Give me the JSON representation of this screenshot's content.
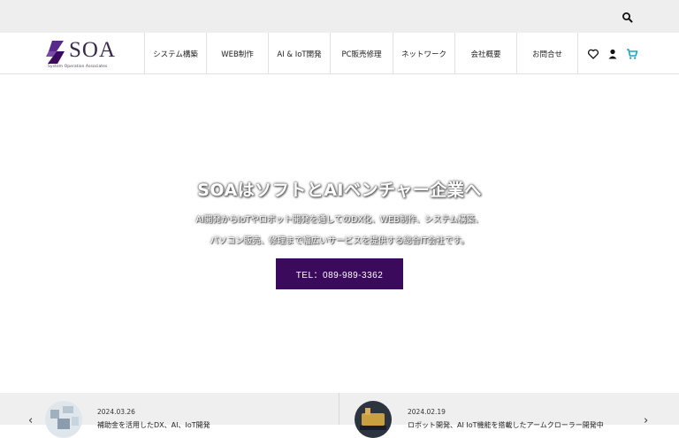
{
  "topbar": {
    "search_icon": "search-icon"
  },
  "logo": {
    "name": "SOA",
    "tagline": "System Operation Associates"
  },
  "nav": {
    "items": [
      {
        "label": "システム構築"
      },
      {
        "label": "WEB制作"
      },
      {
        "label": "AI & IoT開発"
      },
      {
        "label": "PC販売修理"
      },
      {
        "label": "ネットワーク"
      },
      {
        "label": "会社概要"
      },
      {
        "label": "お問合せ"
      }
    ]
  },
  "header_icons": [
    "heart-icon",
    "user-icon",
    "cart-icon"
  ],
  "colors": {
    "accent": "#3b0a5c",
    "cart": "#1aa7b8",
    "topbar": "#eeeeee"
  },
  "hero": {
    "title": "SOAはソフトとAIベンチャー企業へ",
    "line1": "AI開発からIoTやロボット開発を通してのDX化、WEB制作、システム構築、",
    "line2": "パソコン販売、修理まで幅広いサービスを提供する総合IT会社です。",
    "tel_button": "TEL：089-989-3362"
  },
  "news": {
    "items": [
      {
        "date": "2024.03.26",
        "title": "補助金を活用したDX、AI、IoT開発"
      },
      {
        "date": "2024.02.19",
        "title": "ロボット開発、AI IoT機能を搭載したアームクローラー開発中"
      }
    ]
  }
}
